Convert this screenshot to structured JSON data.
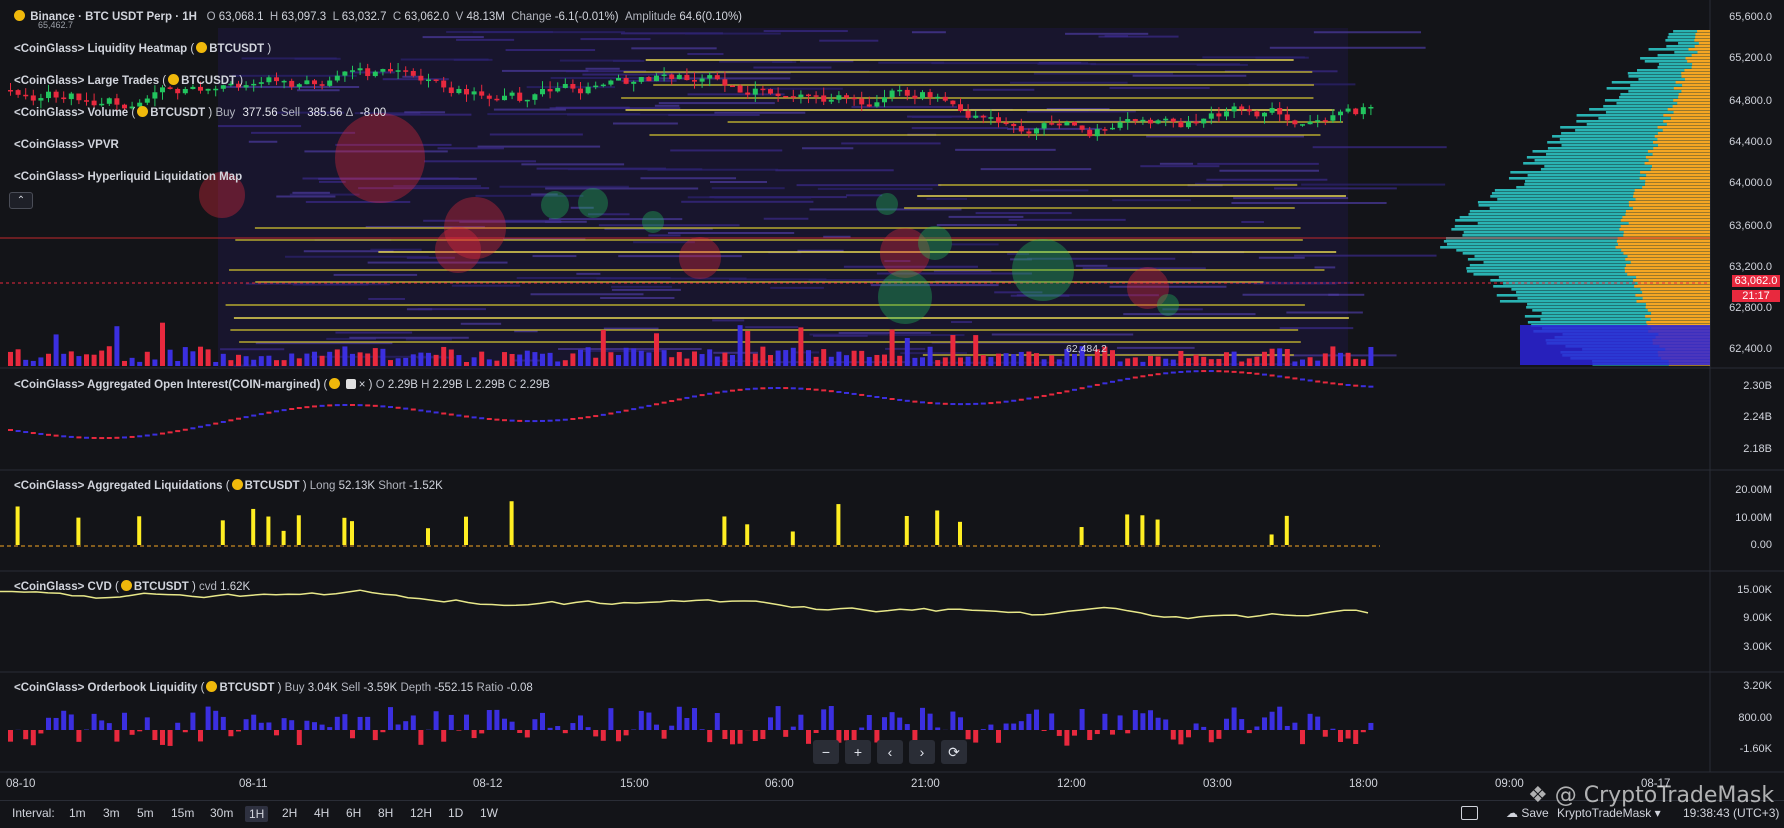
{
  "header": {
    "symbol": "Binance · BTC USDT Perp · 1H",
    "o_label": "O",
    "o_value": "63,068.1",
    "h_label": "H",
    "h_value": "63,097.3",
    "l_label": "L",
    "l_value": "63,032.7",
    "c_label": "C",
    "c_value": "63,062.0",
    "v_label": "V",
    "v_value": "48.13M",
    "change_label": "Change",
    "change_value": "-6.1(-0.01%)",
    "amplitude_label": "Amplitude",
    "amplitude_value": "64.6(0.10%)",
    "hidden_price": "65,462.7"
  },
  "indicators": {
    "heatmap": {
      "name": "<CoinGlass> Liquidity Heatmap",
      "symbol": "BTCUSDT"
    },
    "large_trades": {
      "name": "<CoinGlass> Large Trades",
      "symbol": "BTCUSDT"
    },
    "volume": {
      "name": "<CoinGlass> Volume",
      "symbol": "BTCUSDT",
      "buy_label": "Buy",
      "buy": "377.56",
      "sell_label": "Sell",
      "sell": "385.56",
      "delta_label": "Δ",
      "delta": "-8.00"
    },
    "vpvr": {
      "name": "<CoinGlass> VPVR"
    },
    "hyperliquid": {
      "name": "<CoinGlass> Hyperliquid Liquidation Map"
    },
    "open_interest": {
      "name": "<CoinGlass> Aggregated Open Interest(COIN-margined)",
      "o_label": "O",
      "o": "2.29B",
      "h_label": "H",
      "h": "2.29B",
      "l_label": "L",
      "l": "2.29B",
      "c_label": "C",
      "c": "2.29B"
    },
    "liquidations": {
      "name": "<CoinGlass> Aggregated Liquidations",
      "symbol": "BTCUSDT",
      "long_label": "Long",
      "long": "52.13K",
      "short_label": "Short",
      "short": "-1.52K"
    },
    "cvd": {
      "name": "<CoinGlass> CVD",
      "symbol": "BTCUSDT",
      "cvd_label": "cvd",
      "cvd": "1.62K"
    },
    "orderbook": {
      "name": "<CoinGlass> Orderbook Liquidity",
      "symbol": "BTCUSDT",
      "buy_label": "Buy",
      "buy": "3.04K",
      "sell_label": "Sell",
      "sell": "-3.59K",
      "depth_label": "Depth",
      "depth": "-552.15",
      "ratio_label": "Ratio",
      "ratio": "-0.08"
    }
  },
  "price_axis": [
    "65,600.0",
    "65,200.0",
    "64,800.0",
    "64,400.0",
    "64,000.0",
    "63,600.0",
    "63,200.0",
    "62,800.0",
    "62,400.0"
  ],
  "price_tag": {
    "price": "63,062.0",
    "countdown": "21:17"
  },
  "low_marker": "62,484.2",
  "oi_axis": [
    "2.30B",
    "2.24B",
    "2.18B"
  ],
  "liq_axis": [
    "20.00M",
    "10.00M",
    "0.00"
  ],
  "cvd_axis": [
    "15.00K",
    "9.00K",
    "3.00K"
  ],
  "ob_axis": [
    "3.20K",
    "800.00",
    "-1.60K"
  ],
  "time_axis": [
    "08-10",
    "08-11",
    "08-12",
    "15:00",
    "06:00",
    "21:00",
    "12:00",
    "03:00",
    "18:00",
    "09:00",
    "08-17"
  ],
  "nav_buttons": {
    "zoom_out": "−",
    "zoom_in": "+",
    "scroll_left": "‹",
    "scroll_right": "›",
    "reset": "⟳"
  },
  "toolbar": {
    "interval_label": "Interval:",
    "intervals": [
      "1m",
      "3m",
      "5m",
      "15m",
      "30m",
      "1H",
      "2H",
      "4H",
      "6H",
      "8H",
      "12H",
      "1D",
      "1W"
    ],
    "active_interval": "1H",
    "save_label": "Save",
    "user_label": "KryptoTradeMask",
    "clock": "19:38:43 (UTC+3)"
  },
  "watermark": "@ CryptoTradeMask",
  "colors": {
    "background": "#131418",
    "up": "#22c55e",
    "down": "#e8293e",
    "buy_bar": "#3b2fe0",
    "liq": "#ffee22",
    "cvd_line": "#e8e88a",
    "vpvr_cyan": "#2ec4c4",
    "vpvr_orange": "#f5a623"
  }
}
